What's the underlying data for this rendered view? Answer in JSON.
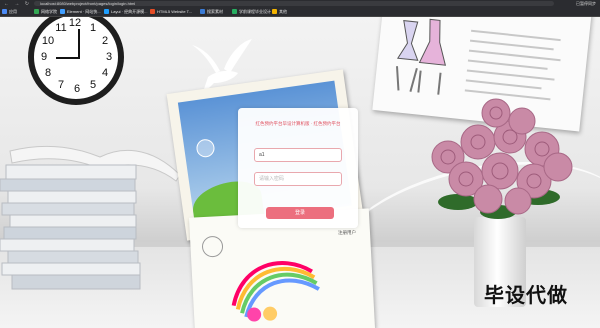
{
  "browser": {
    "nav_glyphs": "← → ↻",
    "url": "localhost:8080/webproject/front/pages/login/login.html",
    "profile": "已暂停同步"
  },
  "bookmarks": [
    {
      "label": "应用",
      "color": "#4c8bf5"
    },
    {
      "label": "网络学院",
      "color": "#34a853"
    },
    {
      "label": "Element · 网站快...",
      "color": "#409eff"
    },
    {
      "label": "Layui · 经典开源模...",
      "color": "#1e9fff"
    },
    {
      "label": "HTML5 Website T...",
      "color": "#e44d26"
    },
    {
      "label": "搜索素材",
      "color": "#3a7bd5"
    },
    {
      "label": "学前课程毕业设计",
      "color": "#27ae60"
    },
    {
      "label": "其他",
      "color": "#f4b400"
    }
  ],
  "login": {
    "title": "红色预约平台毕设计算机版 · 红色预约平台",
    "username_value": "a1",
    "password_placeholder": "请输入密码",
    "submit_label": "登录",
    "register_link": "注册用户"
  },
  "clock": {
    "numerals": [
      "12",
      "1",
      "2",
      "3",
      "4",
      "5",
      "6",
      "7",
      "8",
      "9",
      "10",
      "11"
    ]
  },
  "watermark": "毕设代做",
  "colors": {
    "accent": "#ec6f7e",
    "input_border": "#e9a8ae"
  }
}
